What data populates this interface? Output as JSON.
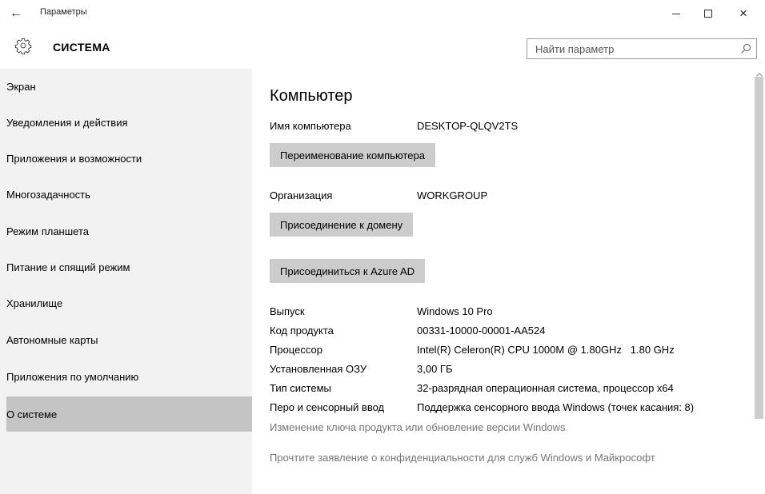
{
  "window": {
    "title": "Параметры",
    "back_glyph": "←",
    "close_glyph": "×",
    "icons": {
      "back": "back-arrow-icon",
      "minimize": "minimize-icon",
      "maximize": "maximize-icon",
      "close": "close-icon"
    }
  },
  "header": {
    "title": "СИСТЕМА",
    "icon": "gear-icon",
    "search_placeholder": "Найти параметр",
    "search_icon": "search-icon"
  },
  "sidebar": {
    "items": [
      {
        "label": "Экран",
        "selected": false
      },
      {
        "label": "Уведомления и действия",
        "selected": false
      },
      {
        "label": "Приложения и возможности",
        "selected": false
      },
      {
        "label": "Многозадачность",
        "selected": false
      },
      {
        "label": "Режим планшета",
        "selected": false
      },
      {
        "label": "Питание и спящий режим",
        "selected": false
      },
      {
        "label": "Хранилище",
        "selected": false
      },
      {
        "label": "Автономные карты",
        "selected": false
      },
      {
        "label": "Приложения по умолчанию",
        "selected": false
      },
      {
        "label": "О системе",
        "selected": true
      }
    ]
  },
  "main": {
    "title": "Компьютер",
    "computer_name_label": "Имя компьютера",
    "computer_name": "DESKTOP-QLQV2TS",
    "rename_button": "Переименование компьютера",
    "organization_label": "Организация",
    "organization": "WORKGROUP",
    "join_domain_button": "Присоединение к домену",
    "join_azure_button": "Присоединиться к Azure AD",
    "specs": [
      {
        "label": "Выпуск",
        "value": "Windows 10 Pro"
      },
      {
        "label": "Код продукта",
        "value": "00331-10000-00001-AA524"
      },
      {
        "label": "Процессор",
        "value": "Intel(R) Celeron(R) CPU 1000M @ 1.80GHz   1.80 GHz"
      },
      {
        "label": "Установленная ОЗУ",
        "value": "3,00 ГБ"
      },
      {
        "label": "Тип системы",
        "value": "32-разрядная операционная система, процессор x64"
      },
      {
        "label": "Перо и сенсорный ввод",
        "value": "Поддержка сенсорного ввода Windows (точек касания: 8)"
      }
    ],
    "change_key_link": "Изменение ключа продукта или обновление версии Windows",
    "privacy_link": "Прочтите заявление о конфиденциальности для служб Windows и Майкрософт"
  },
  "colors": {
    "sidebar_bg": "#f2f2f2",
    "selected_bg": "#c4c4c4",
    "button_bg": "#cccccc",
    "link_text": "#767676"
  }
}
